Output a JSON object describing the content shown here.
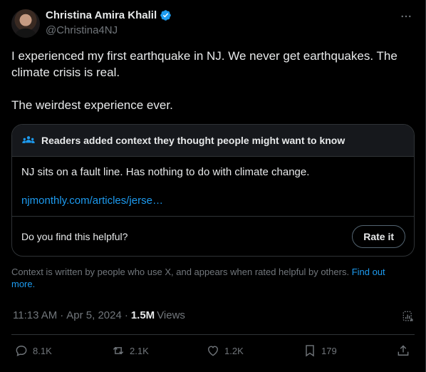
{
  "author": {
    "name": "Christina Amira Khalil",
    "handle": "@Christina4NJ"
  },
  "tweet": {
    "paragraph_1": "I experienced my first earthquake in NJ. We never get earthquakes. The climate crisis is real.",
    "paragraph_2": "The weirdest experience ever."
  },
  "community_note": {
    "header": "Readers added context they thought people might want to know",
    "text": "NJ sits on a fault line. Has nothing to do with climate change.",
    "link": "njmonthly.com/articles/jerse…",
    "helpful_question": "Do you find this helpful?",
    "rate_button": "Rate it"
  },
  "context_info": {
    "text": "Context is written by people who use X, and appears when rated helpful by others.",
    "link": "Find out more."
  },
  "meta": {
    "time": "11:13 AM",
    "date": "Apr 5, 2024",
    "views_count": "1.5M",
    "views_label": "Views"
  },
  "actions": {
    "replies": "8.1K",
    "reposts": "2.1K",
    "likes": "1.2K",
    "bookmarks": "179"
  },
  "colors": {
    "background": "#000000",
    "text": "#e7e9ea",
    "muted": "#71767b",
    "accent": "#1d9bf0",
    "border": "#2f3336"
  },
  "icons": [
    "verified-badge-icon",
    "more-icon",
    "people-icon",
    "stats-icon",
    "reply-icon",
    "repost-icon",
    "like-icon",
    "bookmark-icon",
    "share-icon"
  ]
}
